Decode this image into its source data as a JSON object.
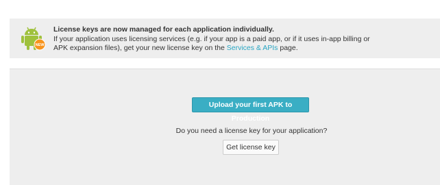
{
  "notice": {
    "icon": "android-new-icon",
    "title": "License keys are now managed for each application individually.",
    "body_line1": "If your application uses licensing services (e.g. if your app is a paid app, or if it uses in-app billing or",
    "body_line2_prefix": "APK expansion files), get your new license key on the ",
    "link_text": "Services & APIs",
    "body_line2_suffix": " page.",
    "badge_text": "NEW",
    "colors": {
      "link": "#2aa6c3",
      "android": "#9fc13c",
      "badge": "#f7941d"
    }
  },
  "main": {
    "upload_button_label": "Upload your first APK to Production",
    "question_text": "Do you need a license key for your application?",
    "license_button_label": "Get license key",
    "colors": {
      "primary_button": "#3aaec4"
    }
  }
}
